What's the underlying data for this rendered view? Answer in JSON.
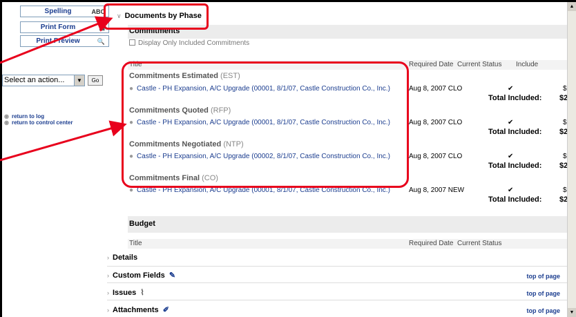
{
  "left_panel": {
    "spelling": "Spelling",
    "spelling_icon": "ABC",
    "print_form": "Print Form",
    "print_preview": "Print Preview",
    "action_select": "Select an action...",
    "go": "Go",
    "return_to_log": "return to log",
    "return_to_control_center": "return to control center"
  },
  "documents_by_phase": {
    "title": "Documents by Phase",
    "commitments_header": "Commitments",
    "display_only_label": "Display Only Included Commitments",
    "columns": {
      "title": "Title",
      "required_date": "Required Date",
      "current_status": "Current Status",
      "include": "Include"
    },
    "groups": [
      {
        "name": "Commitments Estimated",
        "abbr": "(EST)",
        "item": "Castle - PH Expansion, A/C Upgrade (00001, 8/1/07, Castle Construction Co., Inc.)",
        "date": "Aug 8, 2007",
        "status": "CLO",
        "include": "✔",
        "amount": "$",
        "total_label": "Total Included:",
        "total_value": "$2"
      },
      {
        "name": "Commitments Quoted",
        "abbr": "(RFP)",
        "item": "Castle - PH Expansion, A/C Upgrade (00001, 8/1/07, Castle Construction Co., Inc.)",
        "date": "Aug 8, 2007",
        "status": "CLO",
        "include": "✔",
        "amount": "$",
        "total_label": "Total Included:",
        "total_value": "$2"
      },
      {
        "name": "Commitments Negotiated",
        "abbr": "(NTP)",
        "item": "Castle - PH Expansion, A/C Upgrade (00002, 8/1/07, Castle Construction Co., Inc.)",
        "date": "Aug 8, 2007",
        "status": "CLO",
        "include": "✔",
        "amount": "$",
        "total_label": "Total Included:",
        "total_value": "$2"
      },
      {
        "name": "Commitments Final",
        "abbr": "(CO)",
        "item": "Castle - PH Expansion, A/C Upgrade (00001, 8/1/07, Castle Construction Co., Inc.)",
        "date": "Aug 8, 2007",
        "status": "NEW",
        "include": "✔",
        "amount": "$",
        "total_label": "Total Included:",
        "total_value": "$2"
      }
    ],
    "budget_header": "Budget",
    "budget_columns": {
      "title": "Title",
      "required_date": "Required Date",
      "current_status": "Current Status"
    }
  },
  "sections": {
    "details": "Details",
    "custom_fields": "Custom Fields",
    "issues": "Issues",
    "attachments": "Attachments",
    "top_of_page": "top of page"
  },
  "colors": {
    "link": "#1b3d8f",
    "annotation": "#e8001c"
  }
}
